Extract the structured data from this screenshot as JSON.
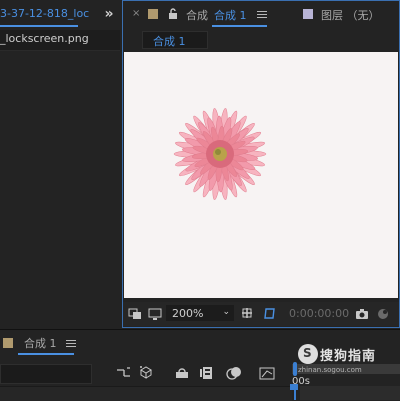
{
  "project": {
    "tab_title": "3-37-12-818_loc",
    "overflow": "»",
    "file_name": "_lockscreen.png"
  },
  "viewer": {
    "close": "×",
    "comp_label": "合成",
    "comp_active": "合成 1",
    "layer_label": "图层 （无）",
    "sub_tab": "合成 1",
    "zoom": "200%",
    "zoom_arrow": "⌄",
    "timecode": "0:00:00:00"
  },
  "timeline": {
    "tab": "合成 1",
    "time_label": "00s"
  },
  "watermark": {
    "logo_glyph": "S",
    "text": "搜狗指南",
    "url": "zhinan.sogou.com"
  },
  "colors": {
    "accent": "#4a90e2",
    "panel_bg": "#232323",
    "canvas_bg": "#f7f3f3",
    "flower_pink": "#f08fa0",
    "flower_center": "#b9a24a"
  },
  "icons": [
    "lock-icon",
    "menu-icon",
    "overflow-icon",
    "region-icon",
    "monitor-icon",
    "grid-icon",
    "mask-icon",
    "camera-icon",
    "color-icon",
    "graph-icon",
    "shy-icon",
    "frame-blend-icon",
    "motion-blur-icon",
    "graph-editor-icon"
  ]
}
